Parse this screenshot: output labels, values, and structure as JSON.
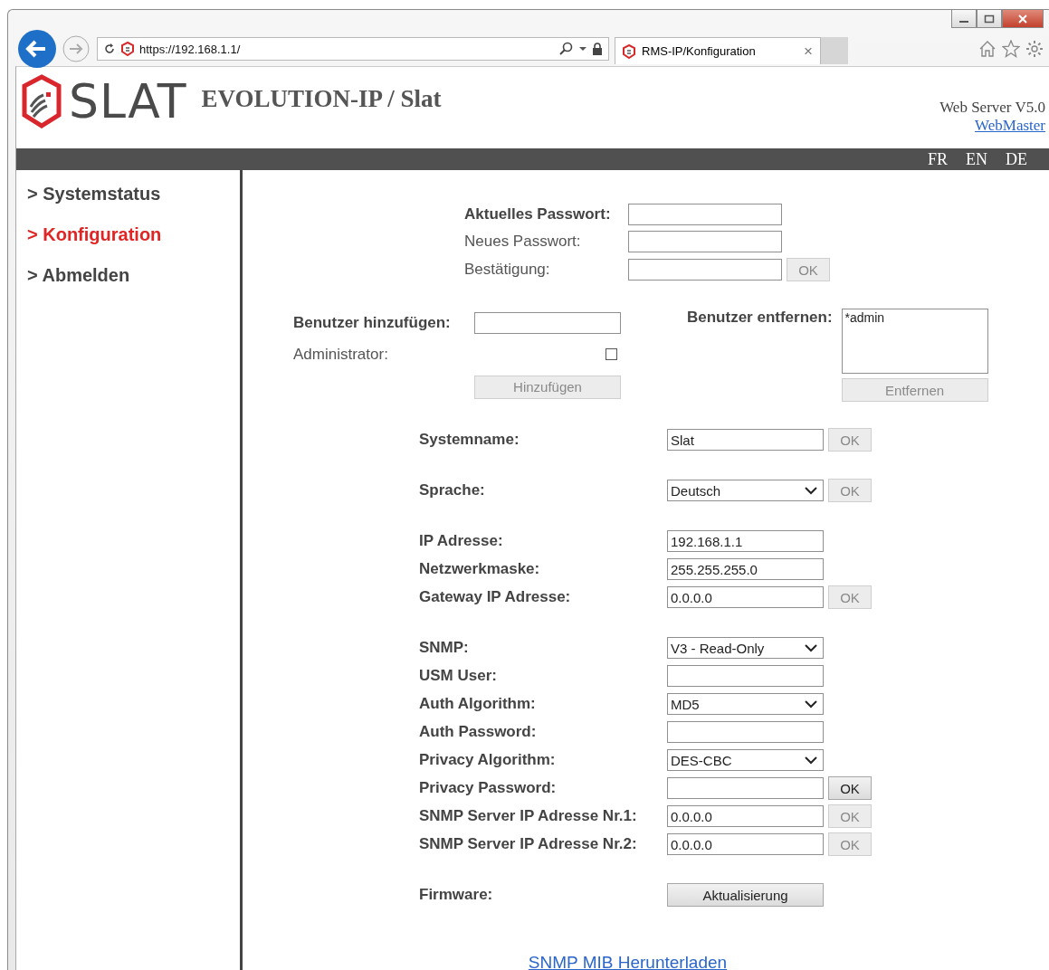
{
  "browser": {
    "url": "https://192.168.1.1/",
    "tab": {
      "title": "RMS-IP/Konfiguration",
      "close": "×"
    }
  },
  "header": {
    "logo": "SLAT",
    "title": "EVOLUTION-IP / Slat",
    "server": "Web Server V5.0",
    "webmaster": "WebMaster"
  },
  "languages": [
    "FR",
    "EN",
    "DE"
  ],
  "sidebar": {
    "items": [
      {
        "label": "> Systemstatus",
        "selected": false
      },
      {
        "label": "> Konfiguration",
        "selected": true
      },
      {
        "label": "> Abmelden",
        "selected": false
      }
    ]
  },
  "password": {
    "rows": [
      {
        "label": "Aktuelles Passwort:",
        "bold": true
      },
      {
        "label": "Neues Passwort:",
        "bold": false
      },
      {
        "label": "Bestätigung:",
        "bold": false,
        "button": {
          "label": "OK",
          "disabled": true
        }
      }
    ]
  },
  "add_user": {
    "label": "Benutzer hinzufügen:",
    "admin_label": "Administrator:",
    "admin_checked": false,
    "button": {
      "label": "Hinzufügen",
      "disabled": true
    }
  },
  "remove_user": {
    "label": "Benutzer entfernen:",
    "users": [
      "*admin"
    ],
    "button": {
      "label": "Entfernen",
      "disabled": true
    }
  },
  "settings": [
    {
      "rows": [
        {
          "label": "Systemname:",
          "kind": "input",
          "value": "Slat",
          "button": {
            "label": "OK",
            "disabled": true
          }
        }
      ]
    },
    {
      "rows": [
        {
          "label": "Sprache:",
          "kind": "select",
          "value": "Deutsch",
          "button": {
            "label": "OK",
            "disabled": true
          }
        }
      ]
    },
    {
      "rows": [
        {
          "label": "IP Adresse:",
          "kind": "input",
          "value": "192.168.1.1"
        },
        {
          "label": "Netzwerkmaske:",
          "kind": "input",
          "value": "255.255.255.0"
        },
        {
          "label": "Gateway IP Adresse:",
          "kind": "input",
          "value": "0.0.0.0",
          "button": {
            "label": "OK",
            "disabled": true
          }
        }
      ]
    },
    {
      "rows": [
        {
          "label": "SNMP:",
          "kind": "select",
          "value": "V3 - Read-Only"
        },
        {
          "label": "USM User:",
          "kind": "input"
        },
        {
          "label": "Auth Algorithm:",
          "kind": "select",
          "value": "MD5"
        },
        {
          "label": "Auth Password:",
          "kind": "input"
        },
        {
          "label": "Privacy Algorithm:",
          "kind": "select",
          "value": "DES-CBC"
        },
        {
          "label": "Privacy Password:",
          "kind": "input",
          "button": {
            "label": "OK",
            "disabled": false
          }
        },
        {
          "label": "SNMP Server IP Adresse Nr.1:",
          "kind": "input",
          "value": "0.0.0.0",
          "button": {
            "label": "OK",
            "disabled": true
          }
        },
        {
          "label": "SNMP Server IP Adresse Nr.2:",
          "kind": "input",
          "value": "0.0.0.0",
          "button": {
            "label": "OK",
            "disabled": true
          }
        }
      ]
    },
    {
      "rows": [
        {
          "label": "Firmware:",
          "kind": "action",
          "button": {
            "label": "Aktualisierung",
            "disabled": false
          }
        }
      ]
    }
  ],
  "download_link": "SNMP MIB Herunterladen"
}
